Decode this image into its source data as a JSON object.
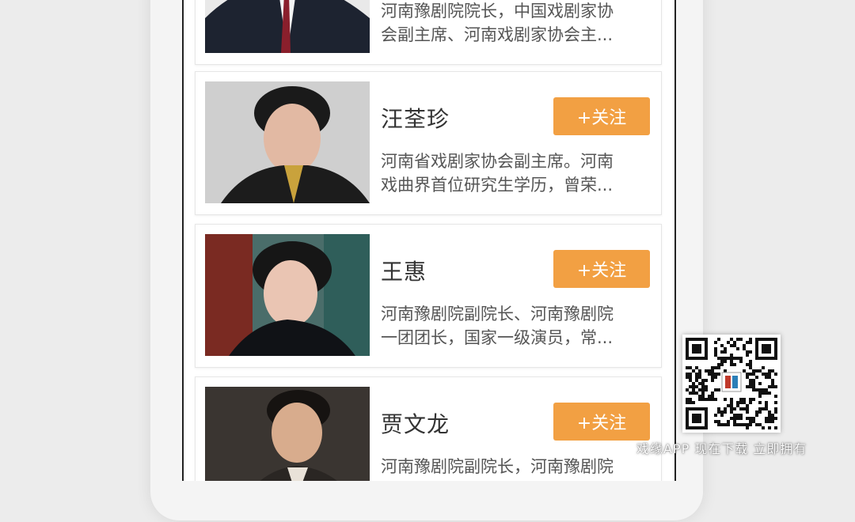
{
  "cards": [
    {
      "name": "",
      "follow_label": "",
      "desc_line1": "河南豫剧院院长，中国戏剧家协",
      "desc_line2": "会副主席、河南戏剧家协会主..."
    },
    {
      "name": "汪荃珍",
      "follow_label": "+关注",
      "desc_line1": "河南省戏剧家协会副主席。河南",
      "desc_line2": "戏曲界首位研究生学历，曾荣..."
    },
    {
      "name": "王惠",
      "follow_label": "+关注",
      "desc_line1": "河南豫剧院副院长、河南豫剧院",
      "desc_line2": "一团团长，国家一级演员，常..."
    },
    {
      "name": "贾文龙",
      "follow_label": "+关注",
      "desc_line1": "河南豫剧院副院长，河南豫剧院",
      "desc_line2": ""
    }
  ],
  "qr": {
    "logo_icon": "opera-mask-icon"
  },
  "watermark": {
    "text": "戏缘APP 现在下载 立即拥有"
  },
  "colors": {
    "follow_button": "#f2a043",
    "text_dark": "#333333",
    "text_desc": "#555555"
  }
}
